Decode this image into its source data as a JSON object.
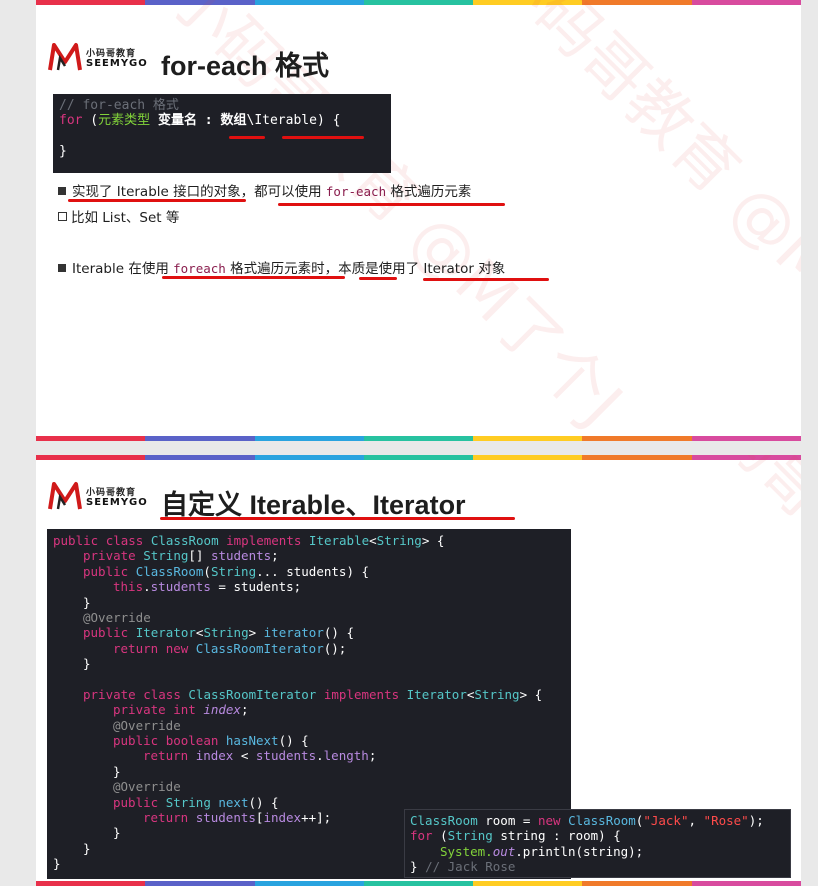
{
  "slide1": {
    "logo": {
      "cn": "小码哥教育",
      "en": "SEEMYGO"
    },
    "title": "for-each 格式",
    "code": {
      "comment": "// for-each 格式",
      "kw_for": "for",
      "open": " (",
      "elem_type": "元素类型",
      "var_name": " 变量名 : ",
      "array": "数组",
      "sep": "\\",
      "iterable": "Iterable",
      "close": ") {",
      "end": "}"
    },
    "bullet1": {
      "pre": "实现了 Iterable 接口的对象，都可以使用 ",
      "code": "for-each",
      "post": " 格式遍历元素"
    },
    "bullet2": "比如 List、Set 等",
    "bullet3": {
      "pre": "Iterable 在使用 ",
      "code": "foreach",
      "post": " 格式遍历元素时，本质是使用了 Iterator 对象"
    }
  },
  "slide2": {
    "logo": {
      "cn": "小码哥教育",
      "en": "SEEMYGO"
    },
    "title": "自定义 Iterable、Iterator",
    "code": {
      "public": "public",
      "class": "class",
      "ClassRoom": "ClassRoom",
      "implements": "implements",
      "Iterable": "Iterable",
      "String": "String",
      "private": "private",
      "students": "students",
      "this": "this",
      "override": "@Override",
      "Iterator": "Iterator",
      "iterator": "iterator",
      "return": "return",
      "new": "new",
      "ClassRoomIterator": "ClassRoomIterator",
      "int": "int",
      "index": "index",
      "boolean": "boolean",
      "hasNext": "hasNext",
      "length": "length",
      "next": "next"
    },
    "usage": {
      "ClassRoom": "ClassRoom",
      "room": " room = ",
      "new": "new",
      "jack": "\"Jack\"",
      "rose": "\"Rose\"",
      "for": "for",
      "String": "String",
      "loop": " string : room) {",
      "system": "System.",
      "out": "out",
      "println": ".println(string);",
      "end": "} ",
      "comment": "// Jack Rose"
    }
  },
  "watermark": "小码哥教育 @M了个J",
  "colors": {
    "accent_red": "#e01010",
    "code_bg": "#1e1f26",
    "keyword": "#d8357f",
    "type": "#55c7c8"
  }
}
